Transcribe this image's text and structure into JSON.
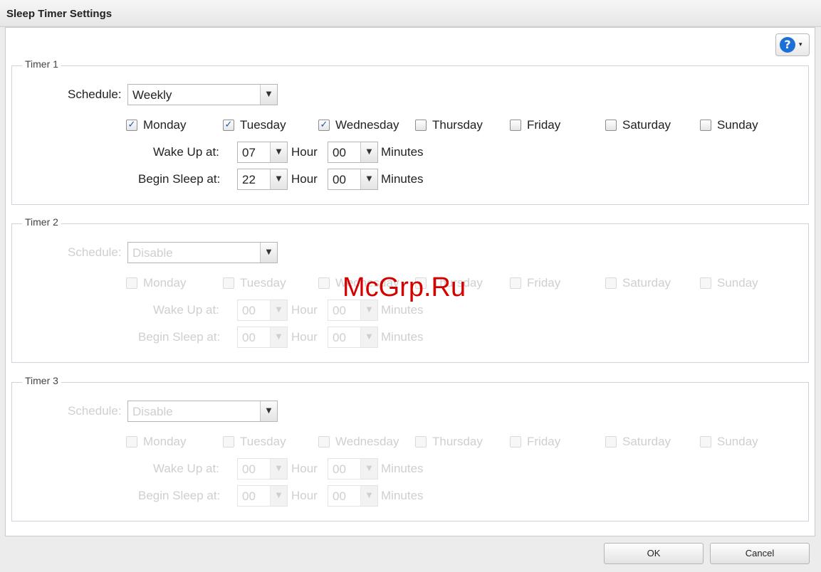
{
  "window": {
    "title": "Sleep Timer Settings"
  },
  "help": {
    "caret": "▾",
    "icon_text": "?"
  },
  "labels": {
    "schedule": "Schedule:",
    "wake_up": "Wake Up at:",
    "begin_sleep": "Begin Sleep at:",
    "hour": "Hour",
    "minutes": "Minutes"
  },
  "timers": [
    {
      "legend": "Timer 1",
      "schedule": "Weekly",
      "enabled": true,
      "days": [
        {
          "label": "Monday",
          "checked": true
        },
        {
          "label": "Tuesday",
          "checked": true
        },
        {
          "label": "Wednesday",
          "checked": true
        },
        {
          "label": "Thursday",
          "checked": false
        },
        {
          "label": "Friday",
          "checked": false
        },
        {
          "label": "Saturday",
          "checked": false
        },
        {
          "label": "Sunday",
          "checked": false
        }
      ],
      "wake_hour": "07",
      "wake_minute": "00",
      "sleep_hour": "22",
      "sleep_minute": "00"
    },
    {
      "legend": "Timer 2",
      "schedule": "Disable",
      "enabled": false,
      "days": [
        {
          "label": "Monday",
          "checked": false
        },
        {
          "label": "Tuesday",
          "checked": false
        },
        {
          "label": "Wednesday",
          "checked": false
        },
        {
          "label": "Thursday",
          "checked": false
        },
        {
          "label": "Friday",
          "checked": false
        },
        {
          "label": "Saturday",
          "checked": false
        },
        {
          "label": "Sunday",
          "checked": false
        }
      ],
      "wake_hour": "00",
      "wake_minute": "00",
      "sleep_hour": "00",
      "sleep_minute": "00"
    },
    {
      "legend": "Timer 3",
      "schedule": "Disable",
      "enabled": false,
      "days": [
        {
          "label": "Monday",
          "checked": false
        },
        {
          "label": "Tuesday",
          "checked": false
        },
        {
          "label": "Wednesday",
          "checked": false
        },
        {
          "label": "Thursday",
          "checked": false
        },
        {
          "label": "Friday",
          "checked": false
        },
        {
          "label": "Saturday",
          "checked": false
        },
        {
          "label": "Sunday",
          "checked": false
        }
      ],
      "wake_hour": "00",
      "wake_minute": "00",
      "sleep_hour": "00",
      "sleep_minute": "00"
    }
  ],
  "watermark": "McGrp.Ru",
  "buttons": {
    "ok": "OK",
    "cancel": "Cancel"
  },
  "colors": {
    "accent": "#1b6fd6",
    "watermark": "#d40000"
  }
}
